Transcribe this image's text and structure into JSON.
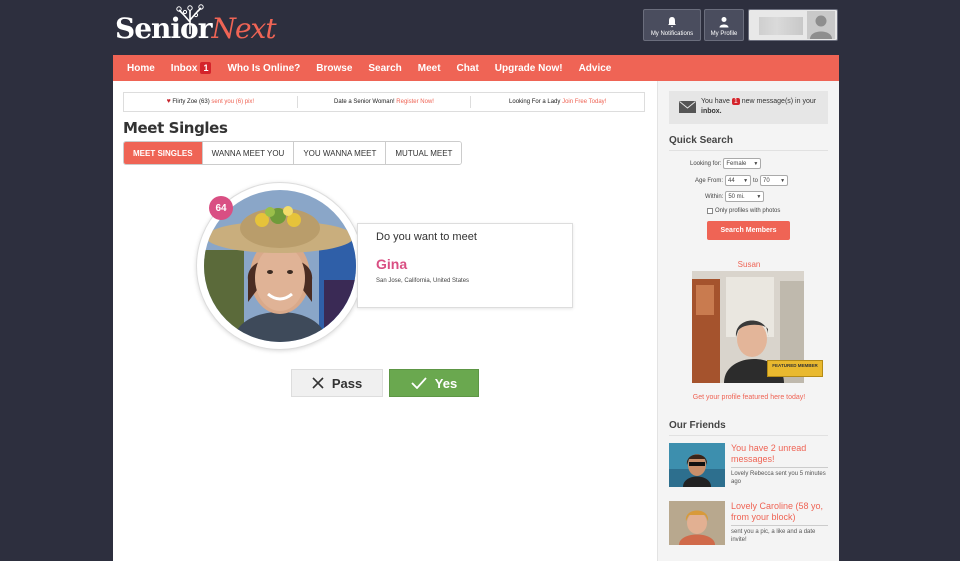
{
  "brand": {
    "name_part1": "Senior",
    "name_part2": "Next"
  },
  "header": {
    "notifications_label": "My Notifications",
    "profile_label": "My Profile"
  },
  "nav": {
    "items": [
      "Home",
      "Inbox",
      "Who Is Online?",
      "Browse",
      "Search",
      "Meet",
      "Chat",
      "Upgrade Now!",
      "Advice"
    ],
    "inbox_badge": "1"
  },
  "ticker": {
    "item1_name": "Flirty Zoe (63)",
    "item1_action": "sent you (6) pix!",
    "item2_text": "Date a Senior Woman!",
    "item2_link": "Register Now!",
    "item3_text": "Looking For a Lady",
    "item3_link": "Join Free Today!"
  },
  "page_title": "Meet Singles",
  "tabs": [
    "MEET SINGLES",
    "WANNA MEET YOU",
    "YOU WANNA MEET",
    "MUTUAL MEET"
  ],
  "profile": {
    "age": "64",
    "question": "Do you want to meet",
    "name": "Gina",
    "location": "San Jose, California, United States"
  },
  "actions": {
    "pass": "Pass",
    "yes": "Yes"
  },
  "sidebar": {
    "message": {
      "prefix": "You have",
      "count": "1",
      "suffix": "new message(s) in your",
      "inbox": "inbox."
    },
    "quick_search": {
      "title": "Quick Search",
      "looking_for_label": "Looking for:",
      "looking_for_value": "Female",
      "age_from_label": "Age From:",
      "age_from_value": "44",
      "age_to_label": "to",
      "age_to_value": "70",
      "within_label": "Within:",
      "within_value": "50 mi.",
      "photos_label": "Only profiles with photos",
      "button": "Search Members"
    },
    "featured": {
      "name": "Susan",
      "badge": "FEATURED MEMBER",
      "link": "Get your profile featured here today!"
    },
    "friends_title": "Our Friends",
    "friends": [
      {
        "title": "You have 2 unread messages!",
        "sub": "Lovely Rebecca sent you 5 minutes ago"
      },
      {
        "title": "Lovely Caroline (58 yo, from your block)",
        "sub": "sent you a pic, a like and a date invite!"
      }
    ]
  },
  "colors": {
    "brand": "#ef6455",
    "accent_pink": "#d94f83",
    "yes_green": "#6aa84f",
    "bg_dark": "#2d2f3e"
  }
}
